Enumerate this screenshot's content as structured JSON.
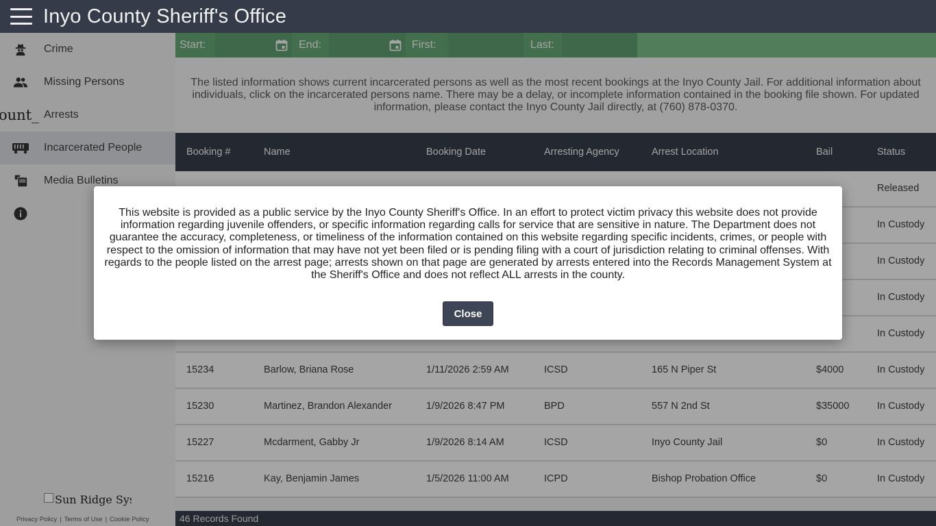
{
  "header": {
    "title": "Inyo County Sheriff's Office"
  },
  "sidebar": {
    "items": [
      {
        "label": "Crime",
        "icon": "detective-icon"
      },
      {
        "label": "Missing Persons",
        "icon": "people-icon"
      },
      {
        "label": "Arrests",
        "icon": "broken-image-icon",
        "broken_alt": "ount_"
      },
      {
        "label": "Incarcerated People",
        "icon": "jail-bus-icon"
      },
      {
        "label": "Media Bulletins",
        "icon": "bulletin-icon"
      },
      {
        "label": "",
        "icon": "info-icon"
      }
    ],
    "footer": {
      "logo_alt": "Sun Ridge Syst",
      "links": [
        "Privacy Policy",
        "Terms of Use",
        "Cookie Policy"
      ]
    }
  },
  "filters": {
    "start_label": "Start:",
    "end_label": "End:",
    "first_label": "First:",
    "last_label": "Last:"
  },
  "info": {
    "text": "The listed information shows current incarcerated persons as well as the most recent bookings at the Inyo County Jail. For additional information about individuals, click on the incarcerated persons name. There may be a delay, or incomplete information contained in the booking file shown. For updated information, please contact the Inyo County Jail directly, at (760) 878-0370."
  },
  "table": {
    "headers": [
      "Booking #",
      "Name",
      "Booking Date",
      "Arresting Agency",
      "Arrest Location",
      "Bail",
      "Status"
    ],
    "rows": [
      {
        "booking": "",
        "name": "",
        "date": "",
        "agency": "",
        "location": "",
        "bail": "",
        "status": "Released"
      },
      {
        "booking": "",
        "name": "",
        "date": "",
        "agency": "",
        "location": "",
        "bail": "",
        "status": "In Custody"
      },
      {
        "booking": "",
        "name": "",
        "date": "",
        "agency": "",
        "location": "",
        "bail": "",
        "status": "In Custody"
      },
      {
        "booking": "",
        "name": "",
        "date": "",
        "agency": "",
        "location": "",
        "bail": "",
        "status": "In Custody"
      },
      {
        "booking": "",
        "name": "",
        "date": "",
        "agency": "",
        "location": "",
        "bail": "",
        "status": "In Custody"
      },
      {
        "booking": "15234",
        "name": "Barlow, Briana Rose",
        "date": "1/11/2026 2:59 AM",
        "agency": "ICSD",
        "location": "165 N Piper St",
        "bail": "$4000",
        "status": "In Custody"
      },
      {
        "booking": "15230",
        "name": "Martinez, Brandon Alexander",
        "date": "1/9/2026 8:47 PM",
        "agency": "BPD",
        "location": "557 N 2nd St",
        "bail": "$35000",
        "status": "In Custody"
      },
      {
        "booking": "15227",
        "name": "Mcdarment, Gabby Jr",
        "date": "1/9/2026 8:14 AM",
        "agency": "ICSD",
        "location": "Inyo County Jail",
        "bail": "$0",
        "status": "In Custody"
      },
      {
        "booking": "15216",
        "name": "Kay, Benjamin James",
        "date": "1/5/2026 11:00 AM",
        "agency": "ICPD",
        "location": "Bishop Probation Office",
        "bail": "$0",
        "status": "In Custody"
      }
    ]
  },
  "status": {
    "records": "46 Records Found"
  },
  "modal": {
    "text": "This website is provided as a public service by the Inyo County Sheriff's Office. In an effort to protect victim privacy this website does not provide information regarding juvenile offenders, or specific information regarding calls for service that are sensitive in nature. The Department does not guarantee the accuracy, completeness, or timeliness of the information contained on this website regarding specific incidents, crimes, or people with respect to the omission of information that may have not yet been filed or is pending filing with a court of jurisdiction relating to criminal offenses. With regards to the people listed on the arrest page; arrests shown on that page are generated by arrests entered into the Records Management System at the Sheriff's Office and does not reflect ALL arrests in the county.",
    "close_label": "Close"
  },
  "colors": {
    "header_bg": "#353b48",
    "filter_bg": "#64a474",
    "button_bg": "#3d4556"
  }
}
